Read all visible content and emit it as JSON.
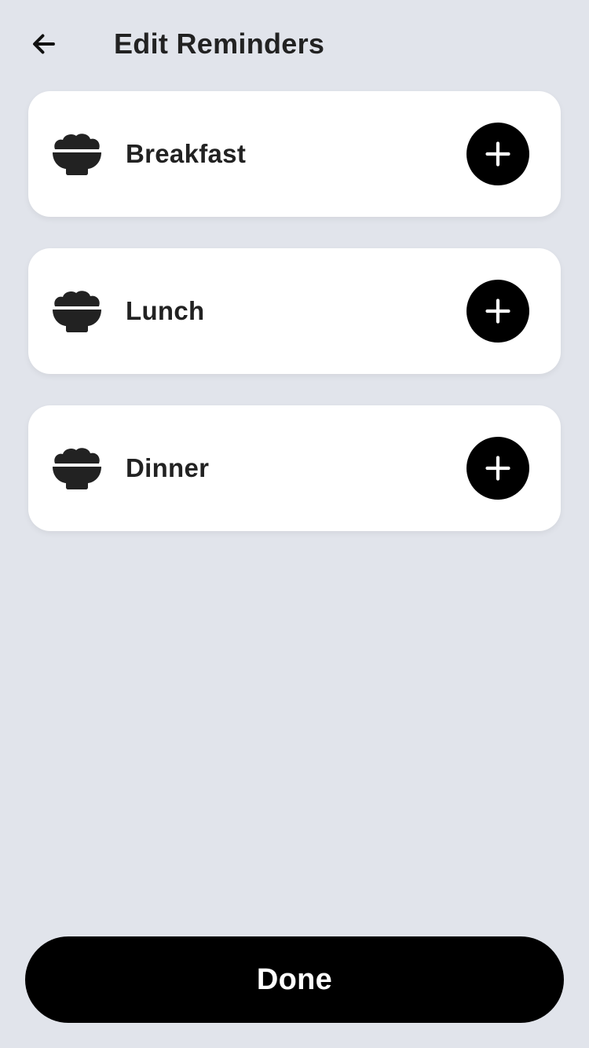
{
  "header": {
    "back_icon": "arrow-left-icon",
    "title": "Edit Reminders"
  },
  "meals": [
    {
      "label": "Breakfast",
      "icon": "rice-bowl-icon",
      "action_icon": "plus-icon"
    },
    {
      "label": "Lunch",
      "icon": "rice-bowl-icon",
      "action_icon": "plus-icon"
    },
    {
      "label": "Dinner",
      "icon": "rice-bowl-icon",
      "action_icon": "plus-icon"
    }
  ],
  "footer": {
    "done_label": "Done"
  },
  "colors": {
    "background": "#e1e4eb",
    "card": "#ffffff",
    "text": "#222222",
    "accent": "#000000"
  }
}
